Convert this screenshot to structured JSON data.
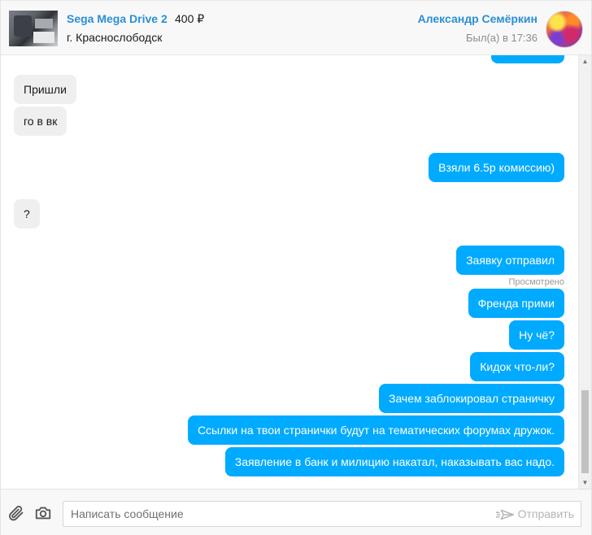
{
  "header": {
    "item_title": "Sega Mega Drive 2",
    "item_price": "400 ₽",
    "item_city": "г. Краснослободск",
    "user_name": "Александр Семёркин",
    "last_seen": "Был(а) в 17:36"
  },
  "messages": [
    {
      "side": "in",
      "text": "Пришли"
    },
    {
      "side": "in",
      "text": "го в вк"
    },
    {
      "side": "out",
      "text": "Взяли 6.5р комиссию)"
    },
    {
      "side": "in",
      "text": "?"
    },
    {
      "side": "out",
      "text": "Заявку отправил"
    },
    {
      "side": "out",
      "text": "Френда прими"
    },
    {
      "side": "out",
      "text": "Ну чё?"
    },
    {
      "side": "out",
      "text": "Кидок что-ли?"
    },
    {
      "side": "out",
      "text": "Зачем заблокировал страничку"
    },
    {
      "side": "out",
      "text": "Ссылки на твои странички будут на тематических форумах дружок."
    },
    {
      "side": "out",
      "text": "Заявление в банк и милицию накатал, наказывать вас надо."
    }
  ],
  "seen_label": "Просмотрено",
  "composer": {
    "placeholder": "Написать сообщение",
    "send_label": "Отправить"
  },
  "icons": {
    "attach": "paperclip-icon",
    "photo": "camera-icon",
    "send": "send-icon"
  },
  "colors": {
    "outgoing_bubble": "#00aaff",
    "incoming_bubble": "#efefef",
    "link_blue": "#2a8fd6"
  }
}
